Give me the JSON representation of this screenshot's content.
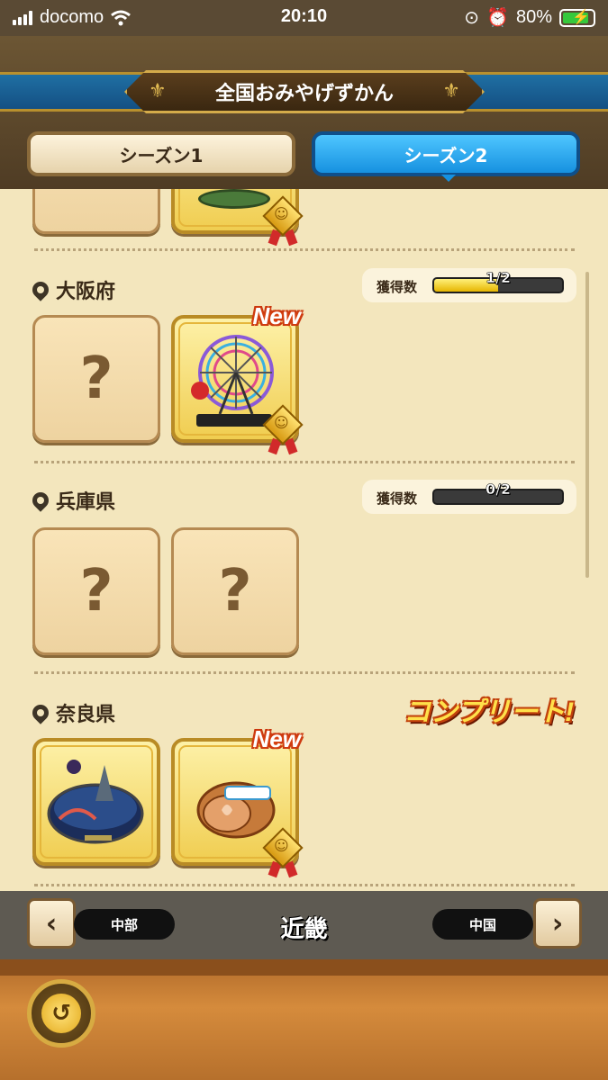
{
  "status_bar": {
    "carrier": "docomo",
    "time": "20:10",
    "battery": "80%"
  },
  "header": {
    "title": "全国おみやげずかん",
    "tabs": [
      {
        "label": "シーズン1"
      },
      {
        "label": "シーズン2"
      }
    ]
  },
  "sections": [
    {
      "name": "大阪府",
      "count_label": "獲得数",
      "count": "1/2",
      "progress": 0.5
    },
    {
      "name": "兵庫県",
      "count_label": "獲得数",
      "count": "0/2",
      "progress": 0
    },
    {
      "name": "奈良県",
      "status": "コンプリート!"
    }
  ],
  "card_marks": {
    "unknown": "?",
    "new_label": "New"
  },
  "region_nav": {
    "prev": "中部",
    "current": "近畿",
    "next": "中国"
  },
  "icons": [
    "signal-icon",
    "wifi-icon",
    "lock-rotation-icon",
    "alarm-icon",
    "battery-icon",
    "location-pin-icon",
    "slime-medal-icon",
    "chevron-left-icon",
    "chevron-right-icon",
    "back-arrow-icon"
  ],
  "colors": {
    "accent_blue": "#1691e0",
    "parchment": "#f3e6bd",
    "gold": "#f0cd50"
  }
}
